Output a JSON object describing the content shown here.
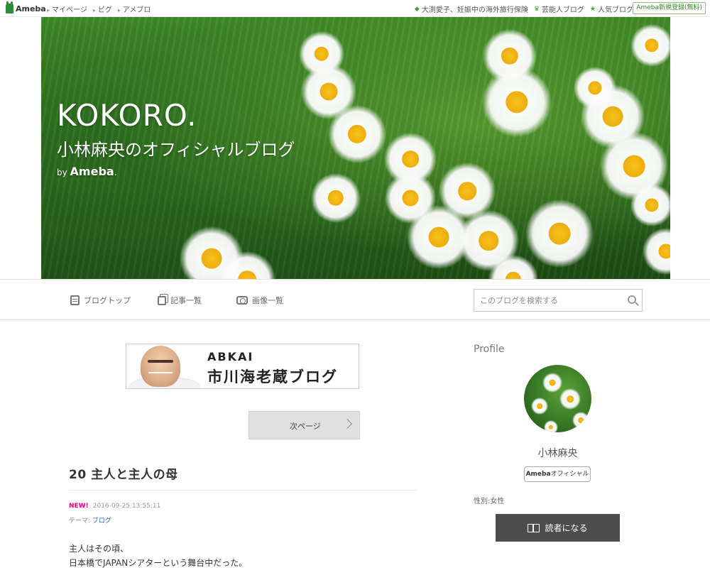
{
  "topbar": {
    "logo": "Ameba",
    "left_links": [
      "マイページ",
      "ピグ",
      "アメブロ"
    ],
    "right_links": [
      "大渕愛子、妊娠中の海外旅行保険",
      "芸能人ブログ",
      "人気ブログ"
    ],
    "register": "Ameba新規登録(無料)"
  },
  "hero": {
    "title_en": "KOKORO.",
    "title_jp": "小林麻央のオフィシャルブログ",
    "by": "by",
    "by_brand": "Ameba"
  },
  "blognav": {
    "items": [
      {
        "label": "ブログトップ",
        "icon": "doc-icon"
      },
      {
        "label": "記事一覧",
        "icon": "copy-icon"
      },
      {
        "label": "画像一覧",
        "icon": "camera-icon"
      }
    ],
    "search_placeholder": "このブログを検索する"
  },
  "banner": {
    "line1": "ABKAI",
    "line2": "市川海老蔵ブログ"
  },
  "pager": {
    "next_label": "次ページ"
  },
  "article": {
    "title": "20 主人と主人の母",
    "new_badge": "NEW!",
    "datetime": "2016-09-25 13:55:11",
    "theme_prefix": "テーマ:",
    "theme": "ブログ",
    "lines": [
      "主人はその頃、",
      "日本橋でJAPANシアターという舞台中だった。"
    ]
  },
  "sidebar": {
    "heading": "Profile",
    "name": "小林麻央",
    "badge_brand": "Ameba",
    "badge_suffix": "オフィシャル",
    "gender": "性別:女性",
    "reader_button": "読者になる"
  },
  "colors": {
    "accent_green": "#3a8a2a",
    "new_badge": "#e4007f",
    "reader_button": "#4d4d4d"
  }
}
